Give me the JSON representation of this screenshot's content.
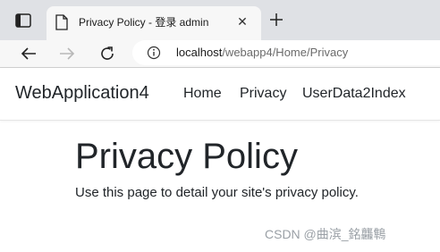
{
  "browser": {
    "tab": {
      "title": "Privacy Policy - 登录 admin",
      "close_glyph": "✕"
    },
    "address": {
      "host": "localhost",
      "path": "/webapp4/Home/Privacy"
    },
    "icons": {
      "tab_actions": "tab-actions-icon",
      "page": "page-icon",
      "close": "close-icon",
      "new_tab": "plus-icon",
      "back": "back-arrow-icon",
      "forward": "forward-arrow-icon",
      "refresh": "refresh-icon",
      "info": "info-icon"
    }
  },
  "site": {
    "brand": "WebApplication4",
    "nav": [
      {
        "label": "Home"
      },
      {
        "label": "Privacy"
      },
      {
        "label": "UserData2Index"
      }
    ]
  },
  "main": {
    "title": "Privacy Policy",
    "text": "Use this page to detail your site's privacy policy."
  },
  "watermark": "CSDN @曲滨_銘龘鶽"
}
